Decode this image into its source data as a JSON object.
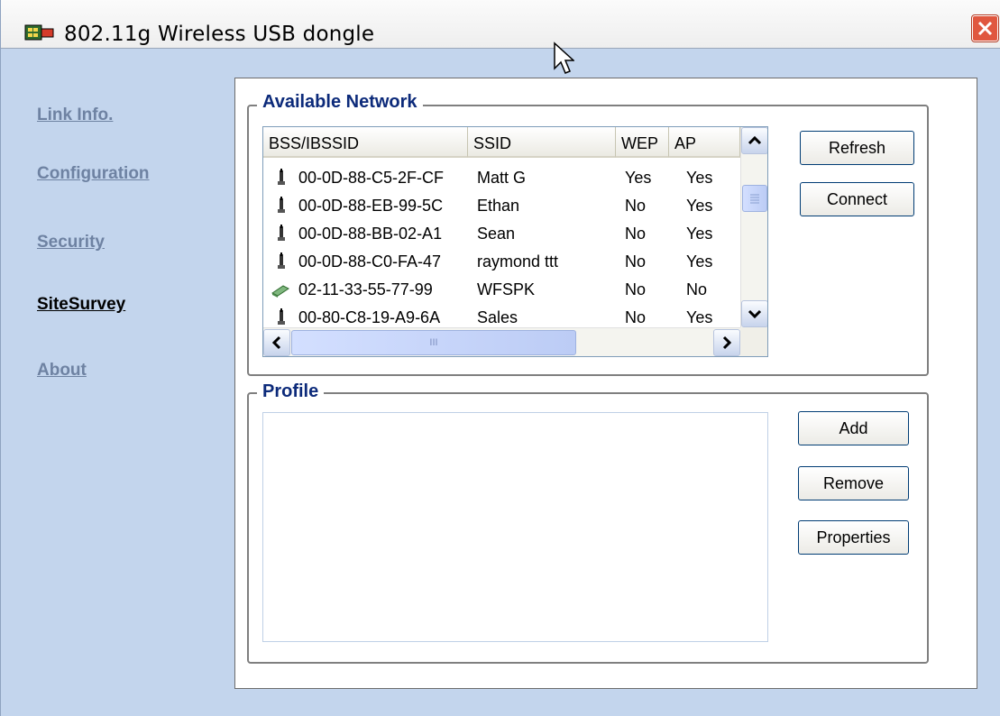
{
  "window": {
    "title": "802.11g Wireless USB dongle"
  },
  "nav": {
    "items": [
      {
        "label": "Link Info."
      },
      {
        "label": "Configuration"
      },
      {
        "label": "Security"
      },
      {
        "label": "SiteSurvey"
      },
      {
        "label": "About"
      }
    ],
    "active": "SiteSurvey"
  },
  "available_network": {
    "legend": "Available Network",
    "columns": [
      "BSS/IBSSID",
      "SSID",
      "WEP",
      "AP"
    ],
    "rows": [
      {
        "icon": "access-point-icon",
        "bssid": "00-0D-88-C5-2F-CF",
        "ssid": "Matt G",
        "wep": "Yes",
        "ap": "Yes"
      },
      {
        "icon": "access-point-icon",
        "bssid": "00-0D-88-EB-99-5C",
        "ssid": "Ethan",
        "wep": "No",
        "ap": "Yes"
      },
      {
        "icon": "access-point-icon",
        "bssid": "00-0D-88-BB-02-A1",
        "ssid": "Sean",
        "wep": "No",
        "ap": "Yes"
      },
      {
        "icon": "access-point-icon",
        "bssid": "00-0D-88-C0-FA-47",
        "ssid": "raymond ttt",
        "wep": "No",
        "ap": "Yes"
      },
      {
        "icon": "adhoc-card-icon",
        "bssid": "02-11-33-55-77-99",
        "ssid": "WFSPK",
        "wep": "No",
        "ap": "No"
      },
      {
        "icon": "access-point-icon",
        "bssid": "00-80-C8-19-A9-6A",
        "ssid": "Sales",
        "wep": "No",
        "ap": "Yes"
      }
    ],
    "scrollbar_h_grip": "III",
    "buttons": {
      "refresh": "Refresh",
      "connect": "Connect"
    }
  },
  "profile": {
    "legend": "Profile",
    "items": [],
    "buttons": {
      "add": "Add",
      "remove": "Remove",
      "properties": "Properties"
    }
  },
  "colors": {
    "legend": "#0c2a7a",
    "nav_inactive": "#6e82a2",
    "background": "#c3d5ed"
  }
}
